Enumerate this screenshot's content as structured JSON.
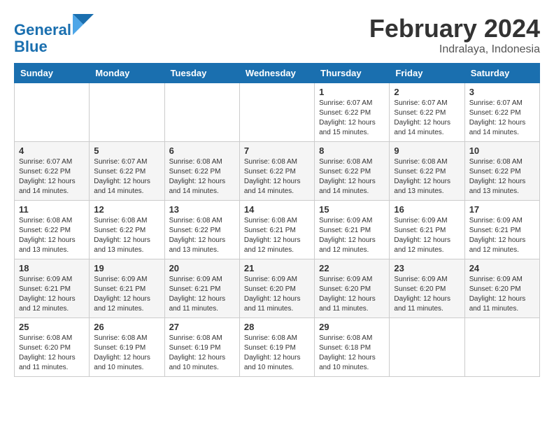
{
  "header": {
    "logo_line1": "General",
    "logo_line2": "Blue",
    "month_title": "February 2024",
    "location": "Indralaya, Indonesia"
  },
  "days_of_week": [
    "Sunday",
    "Monday",
    "Tuesday",
    "Wednesday",
    "Thursday",
    "Friday",
    "Saturday"
  ],
  "weeks": [
    [
      {
        "day": "",
        "info": ""
      },
      {
        "day": "",
        "info": ""
      },
      {
        "day": "",
        "info": ""
      },
      {
        "day": "",
        "info": ""
      },
      {
        "day": "1",
        "info": "Sunrise: 6:07 AM\nSunset: 6:22 PM\nDaylight: 12 hours\nand 15 minutes."
      },
      {
        "day": "2",
        "info": "Sunrise: 6:07 AM\nSunset: 6:22 PM\nDaylight: 12 hours\nand 14 minutes."
      },
      {
        "day": "3",
        "info": "Sunrise: 6:07 AM\nSunset: 6:22 PM\nDaylight: 12 hours\nand 14 minutes."
      }
    ],
    [
      {
        "day": "4",
        "info": "Sunrise: 6:07 AM\nSunset: 6:22 PM\nDaylight: 12 hours\nand 14 minutes."
      },
      {
        "day": "5",
        "info": "Sunrise: 6:07 AM\nSunset: 6:22 PM\nDaylight: 12 hours\nand 14 minutes."
      },
      {
        "day": "6",
        "info": "Sunrise: 6:08 AM\nSunset: 6:22 PM\nDaylight: 12 hours\nand 14 minutes."
      },
      {
        "day": "7",
        "info": "Sunrise: 6:08 AM\nSunset: 6:22 PM\nDaylight: 12 hours\nand 14 minutes."
      },
      {
        "day": "8",
        "info": "Sunrise: 6:08 AM\nSunset: 6:22 PM\nDaylight: 12 hours\nand 14 minutes."
      },
      {
        "day": "9",
        "info": "Sunrise: 6:08 AM\nSunset: 6:22 PM\nDaylight: 12 hours\nand 13 minutes."
      },
      {
        "day": "10",
        "info": "Sunrise: 6:08 AM\nSunset: 6:22 PM\nDaylight: 12 hours\nand 13 minutes."
      }
    ],
    [
      {
        "day": "11",
        "info": "Sunrise: 6:08 AM\nSunset: 6:22 PM\nDaylight: 12 hours\nand 13 minutes."
      },
      {
        "day": "12",
        "info": "Sunrise: 6:08 AM\nSunset: 6:22 PM\nDaylight: 12 hours\nand 13 minutes."
      },
      {
        "day": "13",
        "info": "Sunrise: 6:08 AM\nSunset: 6:22 PM\nDaylight: 12 hours\nand 13 minutes."
      },
      {
        "day": "14",
        "info": "Sunrise: 6:08 AM\nSunset: 6:21 PM\nDaylight: 12 hours\nand 12 minutes."
      },
      {
        "day": "15",
        "info": "Sunrise: 6:09 AM\nSunset: 6:21 PM\nDaylight: 12 hours\nand 12 minutes."
      },
      {
        "day": "16",
        "info": "Sunrise: 6:09 AM\nSunset: 6:21 PM\nDaylight: 12 hours\nand 12 minutes."
      },
      {
        "day": "17",
        "info": "Sunrise: 6:09 AM\nSunset: 6:21 PM\nDaylight: 12 hours\nand 12 minutes."
      }
    ],
    [
      {
        "day": "18",
        "info": "Sunrise: 6:09 AM\nSunset: 6:21 PM\nDaylight: 12 hours\nand 12 minutes."
      },
      {
        "day": "19",
        "info": "Sunrise: 6:09 AM\nSunset: 6:21 PM\nDaylight: 12 hours\nand 12 minutes."
      },
      {
        "day": "20",
        "info": "Sunrise: 6:09 AM\nSunset: 6:21 PM\nDaylight: 12 hours\nand 11 minutes."
      },
      {
        "day": "21",
        "info": "Sunrise: 6:09 AM\nSunset: 6:20 PM\nDaylight: 12 hours\nand 11 minutes."
      },
      {
        "day": "22",
        "info": "Sunrise: 6:09 AM\nSunset: 6:20 PM\nDaylight: 12 hours\nand 11 minutes."
      },
      {
        "day": "23",
        "info": "Sunrise: 6:09 AM\nSunset: 6:20 PM\nDaylight: 12 hours\nand 11 minutes."
      },
      {
        "day": "24",
        "info": "Sunrise: 6:09 AM\nSunset: 6:20 PM\nDaylight: 12 hours\nand 11 minutes."
      }
    ],
    [
      {
        "day": "25",
        "info": "Sunrise: 6:08 AM\nSunset: 6:20 PM\nDaylight: 12 hours\nand 11 minutes."
      },
      {
        "day": "26",
        "info": "Sunrise: 6:08 AM\nSunset: 6:19 PM\nDaylight: 12 hours\nand 10 minutes."
      },
      {
        "day": "27",
        "info": "Sunrise: 6:08 AM\nSunset: 6:19 PM\nDaylight: 12 hours\nand 10 minutes."
      },
      {
        "day": "28",
        "info": "Sunrise: 6:08 AM\nSunset: 6:19 PM\nDaylight: 12 hours\nand 10 minutes."
      },
      {
        "day": "29",
        "info": "Sunrise: 6:08 AM\nSunset: 6:18 PM\nDaylight: 12 hours\nand 10 minutes."
      },
      {
        "day": "",
        "info": ""
      },
      {
        "day": "",
        "info": ""
      }
    ]
  ]
}
